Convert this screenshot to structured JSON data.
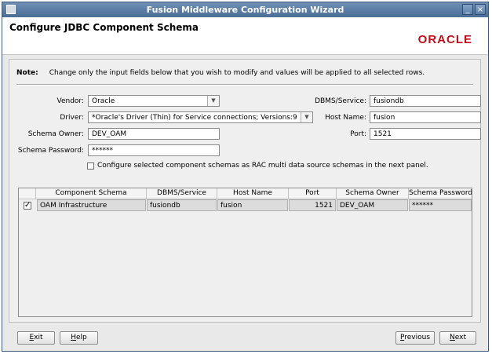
{
  "window": {
    "title": "Fusion Middleware Configuration Wizard",
    "minimize_glyph": "_",
    "close_glyph": "×",
    "app_icon": "window-icon"
  },
  "header": {
    "page_title": "Configure JDBC Component Schema",
    "logo_text": "ORACLE"
  },
  "note": {
    "label": "Note:",
    "text": "Change only the input fields below that you wish to modify and values will be applied to all selected rows."
  },
  "form": {
    "vendor": {
      "label": "Vendor:",
      "value": "Oracle"
    },
    "driver": {
      "label": "Driver:",
      "value": "*Oracle's  Driver (Thin) for Service connections; Versions:9"
    },
    "schema_owner": {
      "label": "Schema Owner:",
      "value": "DEV_OAM"
    },
    "schema_password": {
      "label": "Schema Password:",
      "value": "******"
    },
    "dbms_service": {
      "label": "DBMS/Service:",
      "value": "fusiondb"
    },
    "host_name": {
      "label": "Host Name:",
      "value": "fusion"
    },
    "port": {
      "label": "Port:",
      "value": "1521"
    },
    "rac_checkbox": {
      "label": "Configure selected component schemas as RAC multi data source schemas in the next panel.",
      "checked": false
    }
  },
  "table": {
    "columns": [
      "Component Schema",
      "DBMS/Service",
      "Host Name",
      "Port",
      "Schema Owner",
      "Schema Password"
    ],
    "rows": [
      {
        "checked": true,
        "cells": [
          "OAM Infrastructure",
          "fusiondb",
          "fusion",
          "1521",
          "DEV_OAM",
          "******"
        ]
      }
    ]
  },
  "buttons": {
    "exit": {
      "mnemonic": "E",
      "rest": "xit"
    },
    "help": {
      "mnemonic": "H",
      "rest": "elp"
    },
    "previous": {
      "mnemonic": "P",
      "rest": "revious"
    },
    "next": {
      "mnemonic": "N",
      "rest": "ext"
    }
  },
  "colors": {
    "titlebar": "#4a6d96",
    "oracle_red": "#c2101a"
  }
}
